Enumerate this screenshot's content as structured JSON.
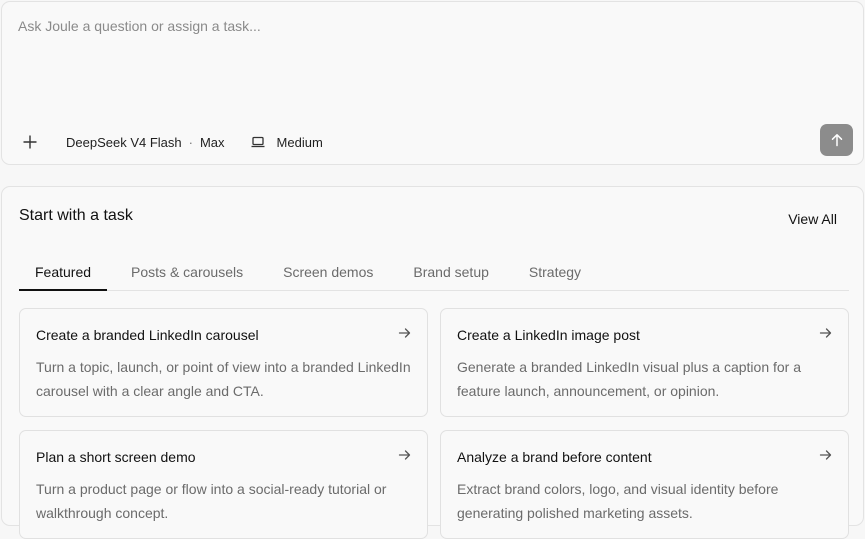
{
  "prompt": {
    "placeholder": "Ask Joule a question or assign a task...",
    "model": "DeepSeek V4 Flash",
    "model_separator": "·",
    "mode": "Max",
    "effort": "Medium"
  },
  "tasks": {
    "title": "Start with a task",
    "view_all": "View All",
    "tabs": [
      {
        "label": "Featured",
        "active": true
      },
      {
        "label": "Posts & carousels",
        "active": false
      },
      {
        "label": "Screen demos",
        "active": false
      },
      {
        "label": "Brand setup",
        "active": false
      },
      {
        "label": "Strategy",
        "active": false
      }
    ],
    "cards": [
      {
        "title": "Create a branded LinkedIn carousel",
        "description": "Turn a topic, launch, or point of view into a branded LinkedIn carousel with a clear angle and CTA."
      },
      {
        "title": "Create a LinkedIn image post",
        "description": "Generate a branded LinkedIn visual plus a caption for a feature launch, announcement, or opinion."
      },
      {
        "title": "Plan a short screen demo",
        "description": "Turn a product page or flow into a social-ready tutorial or walkthrough concept."
      },
      {
        "title": "Analyze a brand before content",
        "description": "Extract brand colors, logo, and visual identity before generating polished marketing assets."
      }
    ]
  },
  "icons": {
    "attach": "plus-icon",
    "effort": "laptop-icon",
    "send": "arrow-up-icon",
    "card_arrow": "arrow-right-icon"
  },
  "colors": {
    "send_button": "#8c8c8c",
    "active_tab_underline": "#111111",
    "muted_text": "#6b6b6b"
  }
}
